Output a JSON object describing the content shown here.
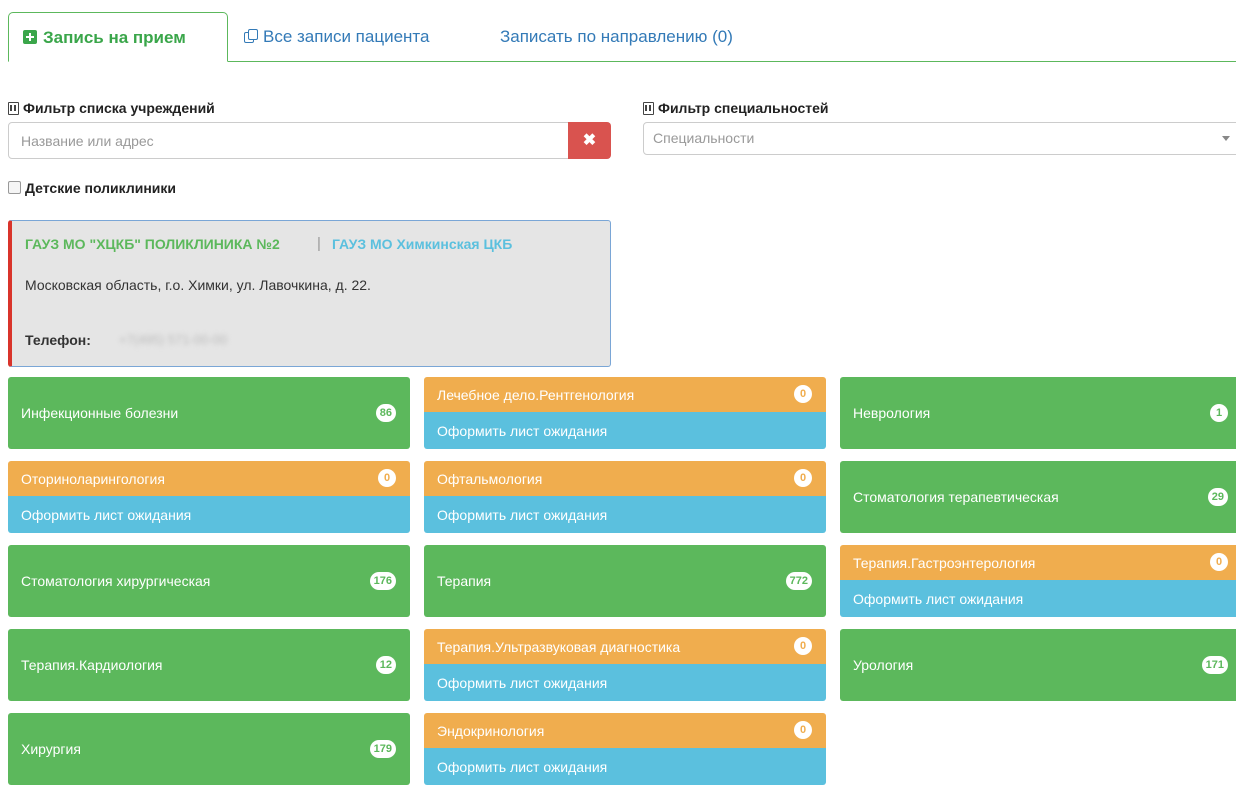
{
  "tabs": {
    "book": "Запись на прием",
    "all": "Все записи пациента",
    "referral": "Записать по направлению (0)"
  },
  "filters": {
    "institutions_label": "Фильтр списка учреждений",
    "institutions_placeholder": "Название или адрес",
    "clear": "✖",
    "specialties_label": "Фильтр специальностей",
    "specialties_placeholder": "Специальности",
    "kids_label": "Детские поликлиники"
  },
  "clinic": {
    "name": "ГАУЗ МО \"ХЦКБ\" ПОЛИКЛИНИКА №2",
    "separator": "|",
    "parent": "ГАУЗ МО Химкинская ЦКБ",
    "address": "Московская область, г.о. Химки, ул. Лавочкина, д. 22.",
    "phone_label": "Телефон:",
    "phone_value": "+7(495) 571-00-00"
  },
  "waitlist_label": "Оформить лист ожидания",
  "specialties": [
    {
      "name": "Инфекционные болезни",
      "count": "86"
    },
    {
      "name": "Лечебное дело.Рентгенология",
      "count": "0"
    },
    {
      "name": "Неврология",
      "count": "1"
    },
    {
      "name": "Оториноларингология",
      "count": "0"
    },
    {
      "name": "Офтальмология",
      "count": "0"
    },
    {
      "name": "Стоматология терапевтическая",
      "count": "29"
    },
    {
      "name": "Стоматология хирургическая",
      "count": "176"
    },
    {
      "name": "Терапия",
      "count": "772"
    },
    {
      "name": "Терапия.Гастроэнтерология",
      "count": "0"
    },
    {
      "name": "Терапия.Кардиология",
      "count": "12"
    },
    {
      "name": "Терапия.Ультразвуковая диагностика",
      "count": "0"
    },
    {
      "name": "Урология",
      "count": "171"
    },
    {
      "name": "Хирургия",
      "count": "179"
    },
    {
      "name": "Эндокринология",
      "count": "0"
    }
  ],
  "colors": {
    "available": "#5cb85c",
    "unavailable": "#f0ad4e",
    "waitlist": "#5bc0de",
    "clear_button": "#d9534f"
  }
}
